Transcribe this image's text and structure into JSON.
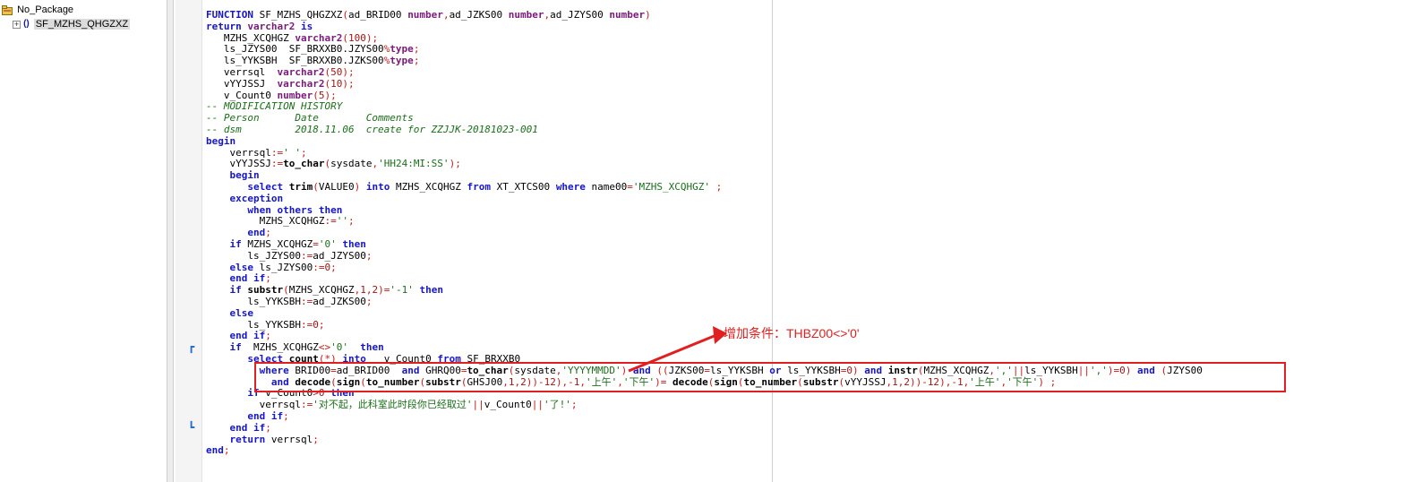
{
  "tree": {
    "package_label": "No_Package",
    "function_label": "SF_MZHS_QHGZXZ",
    "expand_symbol": "+",
    "function_icon_text": "()"
  },
  "annotation": {
    "label": "增加条件：THBZ00<>'0'",
    "color": "#e02020"
  },
  "editor": {
    "lines": [
      "FUNCTION SF_MZHS_QHGZXZ(ad_BRID00 number,ad_JZKS00 number,ad_JZYS00 number)",
      "return varchar2 is",
      "   MZHS_XCQHGZ varchar2(100);",
      "   ls_JZYS00  SF_BRXXB0.JZYS00%type;",
      "   ls_YYKSBH  SF_BRXXB0.JZKS00%type;",
      "   verrsql  varchar2(50);",
      "   vYYJSSJ  varchar2(10);",
      "   v_Count0 number(5);",
      "-- MODIFICATION HISTORY",
      "-- Person      Date        Comments",
      "-- dsm         2018.11.06  create for ZZJJK-20181023-001",
      "begin",
      "    verrsql:=' ';",
      "    vYYJSSJ:=to_char(sysdate,'HH24:MI:SS');",
      "    begin",
      "       select trim(VALUE0) into MZHS_XCQHGZ from XT_XTCS00 where name00='MZHS_XCQHGZ' ;",
      "    exception",
      "       when others then",
      "         MZHS_XCQHGZ:='';",
      "       end;",
      "    if MZHS_XCQHGZ='0' then",
      "       ls_JZYS00:=ad_JZYS00;",
      "    else ls_JZYS00:=0;",
      "    end if;",
      "    if substr(MZHS_XCQHGZ,1,2)='-1' then",
      "       ls_YYKSBH:=ad_JZKS00;",
      "    else",
      "       ls_YYKSBH:=0;",
      "    end if;",
      "    if  MZHS_XCQHGZ<>'0'  then",
      "       select count(*) into   v_Count0 from SF_BRXXB0",
      "         where BRID00=ad_BRID00  and GHRQ00=to_char(sysdate,'YYYYMMDD') and ((JZKS00=ls_YYKSBH or ls_YYKSBH=0) and instr(MZHS_XCQHGZ,','||ls_YYKSBH||',')=0) and (JZYS00",
      "           and decode(sign(to_number(substr(GHSJ00,1,2))-12),-1,'上午','下午')= decode(sign(to_number(substr(vYYJSSJ,1,2))-12),-1,'上午','下午') ;",
      "       if v_Count0>0 then",
      "         verrsql:='对不起，此科室此时段你已经取过'||v_Count0||'了!';",
      "       end if;",
      "    end if;",
      "    return verrsql;",
      "end;"
    ]
  }
}
